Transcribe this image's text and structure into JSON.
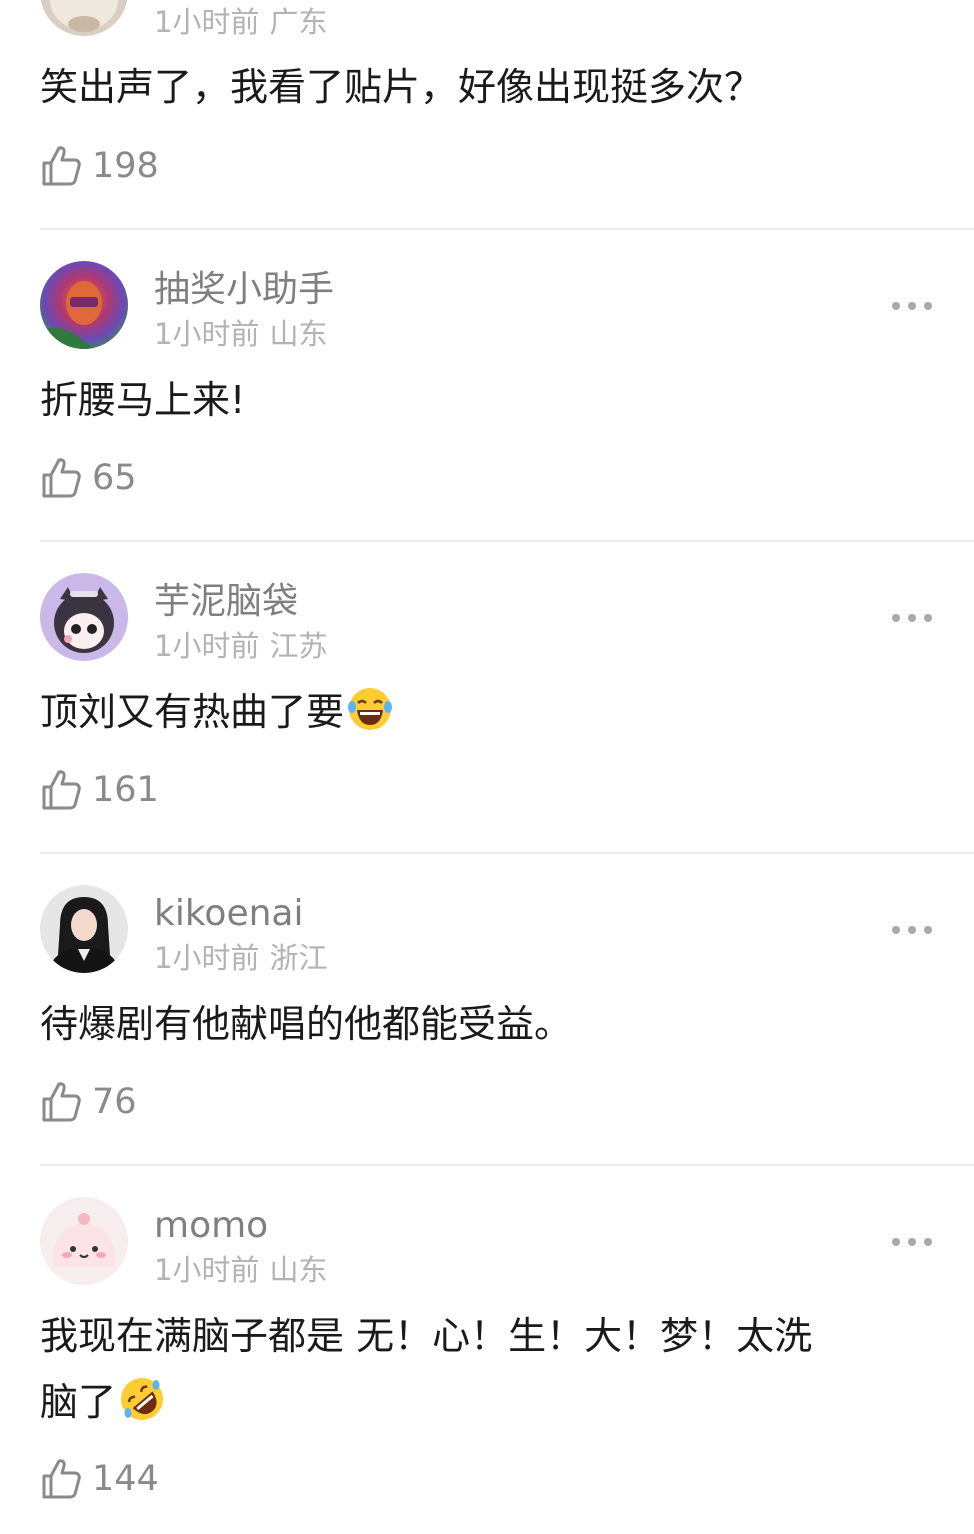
{
  "comments": [
    {
      "username": "",
      "time": "1小时前",
      "region": "广东",
      "text": "笑出声了，我看了贴片，好像出现挺多次？",
      "likes": "198",
      "avatar_icon": "cat-avatar"
    },
    {
      "username": "抽奖小助手",
      "time": "1小时前",
      "region": "山东",
      "text": "折腰马上来!",
      "likes": "65",
      "avatar_icon": "psychedelic-avatar"
    },
    {
      "username": "芋泥脑袋",
      "time": "1小时前",
      "region": "江苏",
      "text": "顶刘又有热曲了要",
      "likes": "161",
      "avatar_icon": "anime-girl-avatar",
      "emoji": "laughing-tears-emoji"
    },
    {
      "username": "kikoenai",
      "time": "1小时前",
      "region": "浙江",
      "text": "待爆剧有他献唱的他都能受益。",
      "likes": "76",
      "avatar_icon": "portrait-avatar"
    },
    {
      "username": "momo",
      "time": "1小时前",
      "region": "山东",
      "text": "我现在满脑子都是 无！心！生！大！梦！太洗",
      "text2": "脑了",
      "likes": "144",
      "avatar_icon": "pink-blob-avatar",
      "emoji": "rofl-emoji"
    }
  ],
  "icons": {
    "like": "thumbs-up-icon",
    "more": "more-dots-icon"
  },
  "colors": {
    "text": "#1a1a1a",
    "username": "#7f7f7f",
    "meta": "#b3b3b3",
    "like": "#8a8a8a",
    "divider": "#ececec"
  }
}
